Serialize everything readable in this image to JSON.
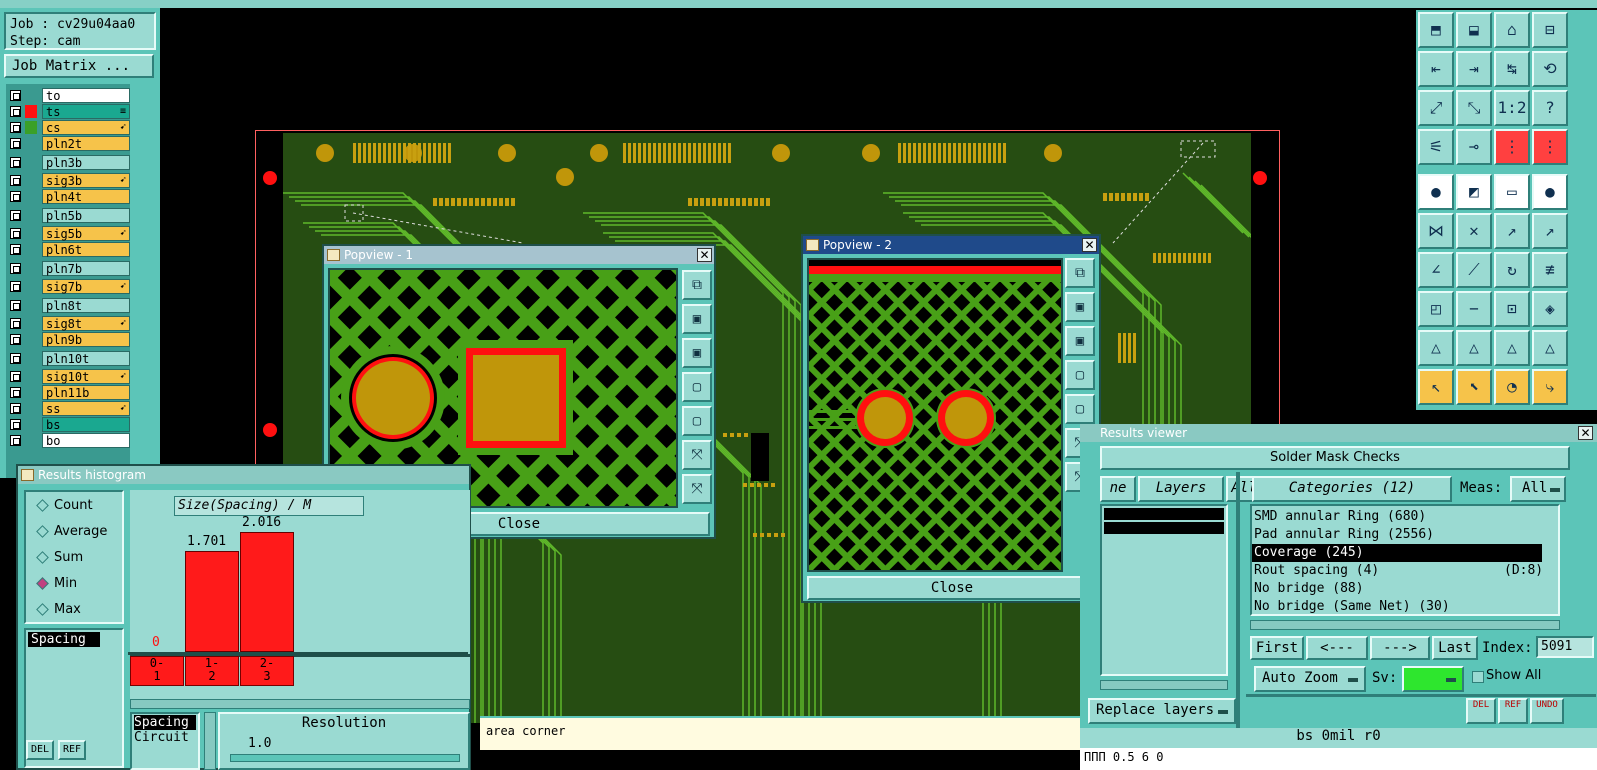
{
  "job": {
    "job_line": "Job : cv29u04aa0",
    "step_line": "Step: cam",
    "matrix_button": "Job Matrix ..."
  },
  "layers": [
    {
      "name": "to",
      "swatch": "",
      "color": "#ffffff",
      "mark": ""
    },
    {
      "name": "ts",
      "swatch": "#ff1010",
      "color": "#1aa890",
      "mark": "≡"
    },
    {
      "name": "cs",
      "swatch": "#3aa028",
      "color": "#f6c34a",
      "mark": "➹"
    },
    {
      "name": "pln2t",
      "swatch": "",
      "color": "#f6c34a",
      "mark": ""
    },
    {
      "name": "pln3b",
      "swatch": "",
      "color": "#9adad2",
      "mark": ""
    },
    {
      "name": "sig3b",
      "swatch": "",
      "color": "#f6c34a",
      "mark": "➹"
    },
    {
      "name": "pln4t",
      "swatch": "",
      "color": "#f6c34a",
      "mark": ""
    },
    {
      "name": "pln5b",
      "swatch": "",
      "color": "#9adad2",
      "mark": ""
    },
    {
      "name": "sig5b",
      "swatch": "",
      "color": "#f6c34a",
      "mark": "➹"
    },
    {
      "name": "pln6t",
      "swatch": "",
      "color": "#f6c34a",
      "mark": ""
    },
    {
      "name": "pln7b",
      "swatch": "",
      "color": "#9adad2",
      "mark": ""
    },
    {
      "name": "sig7b",
      "swatch": "",
      "color": "#f6c34a",
      "mark": "➹"
    },
    {
      "name": "pln8t",
      "swatch": "",
      "color": "#9adad2",
      "mark": ""
    },
    {
      "name": "sig8t",
      "swatch": "",
      "color": "#f6c34a",
      "mark": "➹"
    },
    {
      "name": "pln9b",
      "swatch": "",
      "color": "#f6c34a",
      "mark": ""
    },
    {
      "name": "pln10t",
      "swatch": "",
      "color": "#9adad2",
      "mark": ""
    },
    {
      "name": "sig10t",
      "swatch": "",
      "color": "#f6c34a",
      "mark": "➹"
    },
    {
      "name": "pln11b",
      "swatch": "",
      "color": "#f6c34a",
      "mark": ""
    },
    {
      "name": "ss",
      "swatch": "",
      "color": "#f6c34a",
      "mark": "➹"
    },
    {
      "name": "bs",
      "swatch": "",
      "color": "#1aa890",
      "mark": ""
    },
    {
      "name": "bo",
      "swatch": "",
      "color": "#ffffff",
      "mark": ""
    }
  ],
  "popview1": {
    "title": "Popview - 1",
    "close": "Close"
  },
  "popview2": {
    "title": "Popview - 2",
    "close": "Close"
  },
  "histogram": {
    "title": "Results histogram",
    "modes": [
      {
        "label": "Count",
        "selected": false
      },
      {
        "label": "Average",
        "selected": false
      },
      {
        "label": "Sum",
        "selected": false
      },
      {
        "label": "Min",
        "selected": true
      },
      {
        "label": "Max",
        "selected": false
      }
    ],
    "list_item": "Spacing",
    "chart_title": "Size(Spacing) / M",
    "bins": [
      {
        "label": "0-\n1",
        "value": 0,
        "value_label": "0"
      },
      {
        "label": "1-\n2",
        "value": 1.701,
        "value_label": "1.701"
      },
      {
        "label": "2-\n3",
        "value": 2.016,
        "value_label": "2.016"
      }
    ],
    "bottom_list": [
      "Spacing",
      "Circuit"
    ],
    "resolution_label": "Resolution",
    "resolution_value": "1.0",
    "del_button": "DEL",
    "ref_button": "REF"
  },
  "results_viewer": {
    "title": "Results viewer",
    "header": "Solder Mask Checks",
    "tab_partial": "ne",
    "tab_layers": "Layers",
    "tab_all": "All",
    "categories_button": "Categories (12)",
    "meas_label": "Meas:",
    "meas_value": "All",
    "categories": [
      {
        "label": "SMD annular Ring (680)",
        "extra": "",
        "selected": false
      },
      {
        "label": "Pad annular Ring (2556)",
        "extra": "",
        "selected": false
      },
      {
        "label": "Coverage (245)",
        "extra": "",
        "selected": true
      },
      {
        "label": "Rout spacing (4)",
        "extra": "(D:8)",
        "selected": false
      },
      {
        "label": "No bridge (88)",
        "extra": "",
        "selected": false
      },
      {
        "label": "No bridge (Same Net) (30)",
        "extra": "",
        "selected": false
      }
    ],
    "nav": {
      "first": "First",
      "prev": "<---",
      "next": "--->",
      "last": "Last",
      "index_label": "Index:",
      "index_value": "5091"
    },
    "auto_zoom": "Auto Zoom",
    "sv_label": "Sv:",
    "sv_color": "#2ee62e",
    "show_all": "Show All",
    "replace_layers": "Replace layers",
    "footer_buttons": [
      "DEL",
      "REF",
      "UNDO"
    ],
    "status_line": "bs 0mil  r0",
    "partial_line": "ППП             0.5 6 0"
  },
  "status": {
    "message": "area corner"
  },
  "colors": {
    "panel": "#5cc5b8",
    "board": "#264d12",
    "copper": "#c0960a",
    "red": "#ff1010",
    "hatch": "#3c8a14"
  }
}
